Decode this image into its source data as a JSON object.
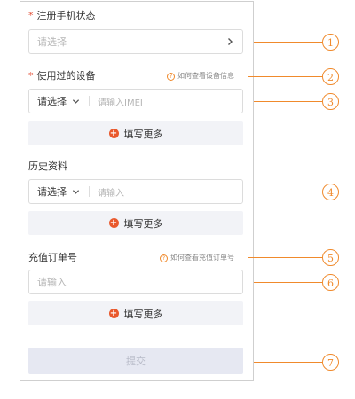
{
  "form": {
    "register_status": {
      "required_mark": "*",
      "label": "注册手机状态",
      "placeholder": "请选择"
    },
    "used_device": {
      "required_mark": "*",
      "label": "使用过的设备",
      "help_text": "如何查看设备信息",
      "select_value": "请选择",
      "input_placeholder": "请输入IMEI",
      "more_label": "填写更多"
    },
    "history": {
      "label": "历史资料",
      "select_value": "请选择",
      "input_placeholder": "请输入",
      "more_label": "填写更多"
    },
    "recharge_order": {
      "label": "充值订单号",
      "help_text": "如何查看充值订单号",
      "input_placeholder": "请输入",
      "more_label": "填写更多"
    },
    "submit_label": "提交"
  },
  "icons": {
    "help": "question-circle-icon",
    "plus": "plus-circle-icon",
    "chevron_right": "chevron-right-icon",
    "chevron_down": "chevron-down-icon",
    "help_glyph": "?",
    "plus_glyph": "+"
  },
  "callouts": [
    "1",
    "2",
    "3",
    "4",
    "5",
    "6",
    "7"
  ],
  "colors": {
    "accent": "#f08a2c",
    "required": "#e4533b",
    "plus": "#e9582c",
    "more_bg": "#f2f3f7",
    "submit_bg": "#e6e8f2",
    "submit_text": "#b8bbc8"
  }
}
